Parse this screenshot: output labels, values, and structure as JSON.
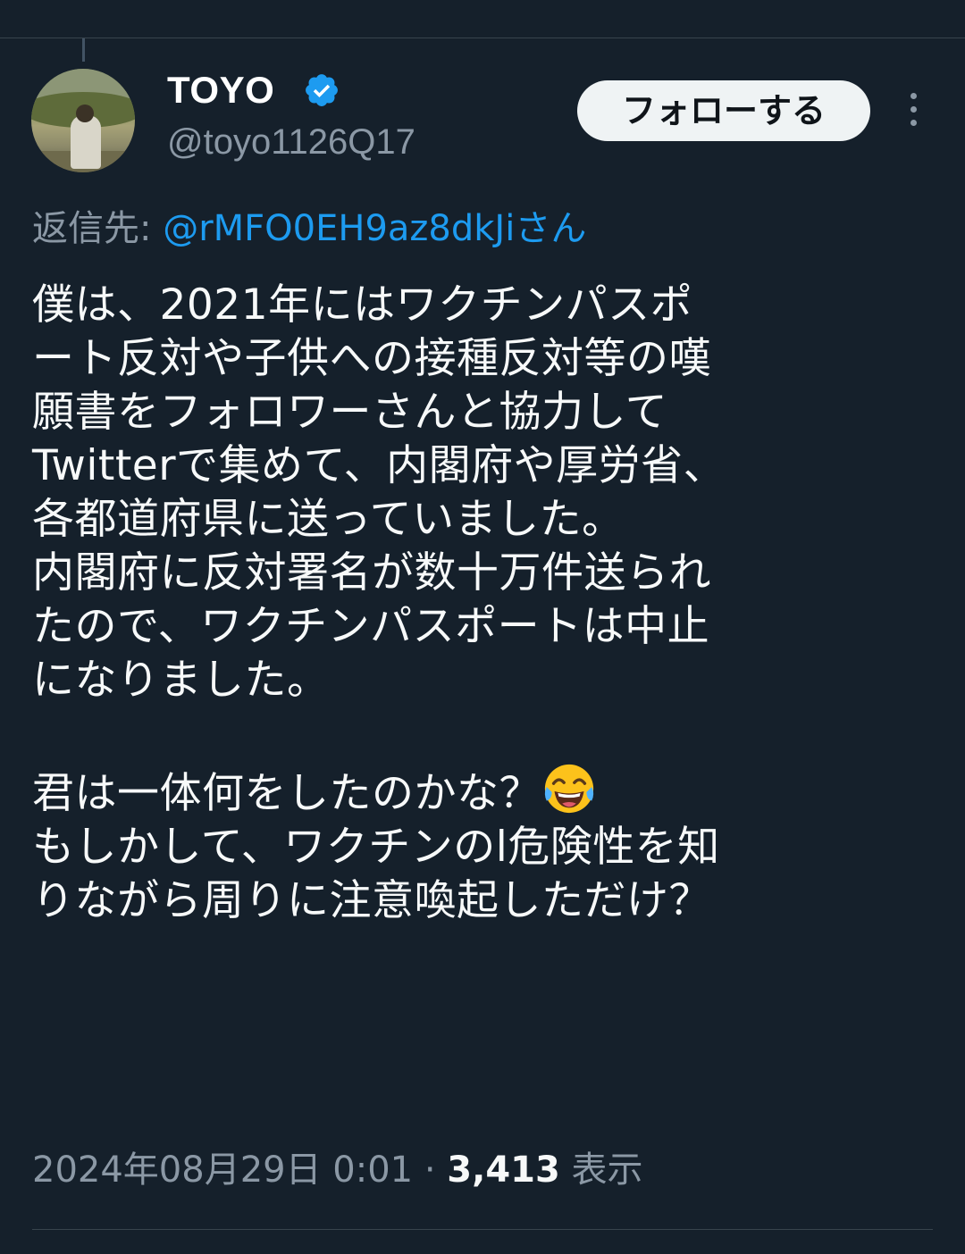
{
  "tweet": {
    "author": {
      "display_name": "TOYO",
      "handle": "@toyo1126Q17",
      "verified": true
    },
    "follow_label": "フォローする",
    "reply_to": {
      "prefix": "返信先: ",
      "user": "@rMFO0EH9az8dkJiさん"
    },
    "text_part1": "僕は、2021年にはワクチンパスポ\nート反対や子供への接種反対等の嘆\n願書をフォロワーさんと協力して\nTwitterで集めて、内閣府や厚労省、\n各都道府県に送っていました。\n内閣府に反対署名が数十万件送られ\nたので、ワクチンパスポートは中止\nになりました。\n\n君は一体何をしたのかな？",
    "emoji": "face-with-tears-of-joy",
    "text_part2": "\nもしかして、ワクチンのl危険性を知\nりながら周りに注意喚起しただけ？",
    "timestamp": "2024年08月29日 0:01",
    "separator": " · ",
    "views_count": "3,413",
    "views_label": " 表示"
  },
  "colors": {
    "background": "#15202b",
    "text": "#f7f9f9",
    "secondary": "#8b98a5",
    "link": "#1d9bf0",
    "verified": "#1d9bf0",
    "follow_bg": "#eff3f4"
  },
  "icons": {
    "verified": "verified-badge-icon",
    "more": "more-vertical-icon"
  }
}
